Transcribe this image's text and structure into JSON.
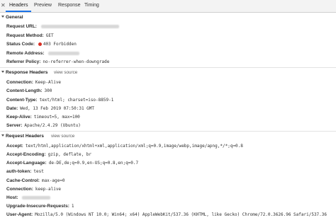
{
  "tabs": [
    {
      "label": "Headers",
      "active": true
    },
    {
      "label": "Preview",
      "active": false
    },
    {
      "label": "Response",
      "active": false
    },
    {
      "label": "Timing",
      "active": false
    }
  ],
  "general": {
    "title": "General",
    "request_url_label": "Request URL:",
    "request_method_label": "Request Method:",
    "request_method": "GET",
    "status_code_label": "Status Code:",
    "status_code": "403 Forbidden",
    "remote_address_label": "Remote Address:",
    "referrer_policy_label": "Referrer Policy:",
    "referrer_policy": "no-referrer-when-downgrade"
  },
  "response_headers": {
    "title": "Response Headers",
    "view_source": "view source",
    "rows": [
      {
        "key": "Connection:",
        "value": "Keep-Alive"
      },
      {
        "key": "Content-Length:",
        "value": "300"
      },
      {
        "key": "Content-Type:",
        "value": "text/html; charset=iso-8859-1"
      },
      {
        "key": "Date:",
        "value": "Wed, 13 Feb 2019 07:50:31 GMT"
      },
      {
        "key": "Keep-Alive:",
        "value": "timeout=5, max=100"
      },
      {
        "key": "Server:",
        "value": "Apache/2.4.29 (Ubuntu)"
      }
    ]
  },
  "request_headers": {
    "title": "Request Headers",
    "view_source": "view source",
    "rows": [
      {
        "key": "Accept:",
        "value": "text/html,application/xhtml+xml,application/xml;q=0.9,image/webp,image/apng,*/*;q=0.8"
      },
      {
        "key": "Accept-Encoding:",
        "value": "gzip, deflate, br"
      },
      {
        "key": "Accept-Language:",
        "value": "de-DE,de;q=0.9,en-US;q=0.8,en;q=0.7"
      },
      {
        "key": "auth-token:",
        "value": "test"
      },
      {
        "key": "Cache-Control:",
        "value": "max-age=0"
      },
      {
        "key": "Connection:",
        "value": "keep-alive"
      },
      {
        "key": "Host:",
        "value": ""
      },
      {
        "key": "Upgrade-Insecure-Requests:",
        "value": "1"
      },
      {
        "key": "User-Agent:",
        "value": "Mozilla/5.0 (Windows NT 10.0; Win64; x64) AppleWebKit/537.36 (KHTML, like Gecko) Chrome/72.0.3626.96 Safari/537.36"
      }
    ]
  },
  "colors": {
    "status_error": "#d93025",
    "tab_active_underline": "#1a73e8"
  }
}
